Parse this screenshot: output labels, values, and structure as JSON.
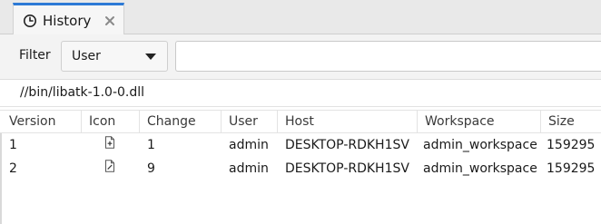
{
  "tab": {
    "icon": "history-icon",
    "label": "History",
    "close_icon": "close-icon"
  },
  "filter": {
    "label": "Filter",
    "selected": "User",
    "dropdown_icon": "chevron-down-icon",
    "input_value": ""
  },
  "path": "//bin/libatk-1.0-0.dll",
  "table": {
    "columns": [
      "Version",
      "Icon",
      "Change",
      "User",
      "Host",
      "Workspace",
      "Size"
    ],
    "rows": [
      {
        "version": "1",
        "icon": "file-added-icon",
        "change": "1",
        "user": "admin",
        "host": "DESKTOP-RDKH1SV",
        "workspace": "admin_workspace",
        "size": "159295"
      },
      {
        "version": "2",
        "icon": "file-edit-icon",
        "change": "9",
        "user": "admin",
        "host": "DESKTOP-RDKH1SV",
        "workspace": "admin_workspace",
        "size": "159295"
      }
    ]
  },
  "colors": {
    "active_tab_accent": "#2d7ad6",
    "tabstrip_bg": "#e9e9e9",
    "filter_bg": "#f3f3f3"
  }
}
